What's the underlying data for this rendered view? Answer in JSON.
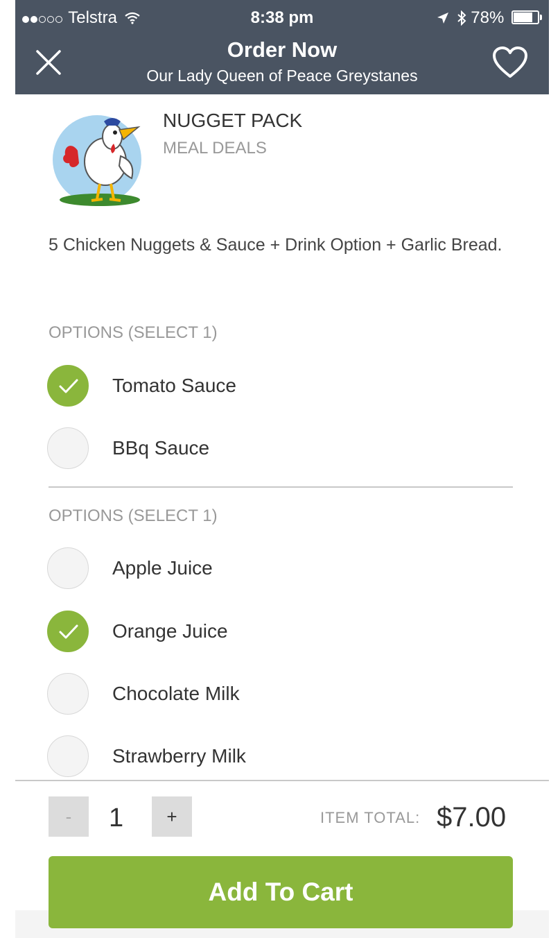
{
  "status_bar": {
    "carrier": "Telstra",
    "time": "8:38 pm",
    "battery": "78%",
    "battery_level": 0.78
  },
  "nav": {
    "title": "Order Now",
    "subtitle": "Our Lady Queen of Peace Greystanes"
  },
  "item": {
    "name": "NUGGET PACK",
    "category": "MEAL DEALS",
    "description": "5 Chicken Nuggets & Sauce + Drink Option + Garlic Bread."
  },
  "option_groups": [
    {
      "title": "OPTIONS (SELECT 1)",
      "options": [
        {
          "label": "Tomato Sauce",
          "selected": true
        },
        {
          "label": "BBq Sauce",
          "selected": false
        }
      ]
    },
    {
      "title": "OPTIONS (SELECT 1)",
      "options": [
        {
          "label": "Apple Juice",
          "selected": false
        },
        {
          "label": "Orange Juice",
          "selected": true
        },
        {
          "label": "Chocolate Milk",
          "selected": false
        },
        {
          "label": "Strawberry Milk",
          "selected": false
        }
      ]
    }
  ],
  "footer": {
    "minus": "-",
    "plus": "+",
    "quantity": "1",
    "total_label": "ITEM TOTAL:",
    "total": "$7.00",
    "add_to_cart": "Add To Cart"
  },
  "colors": {
    "header_bg": "#4a5462",
    "accent_green": "#8ab63c"
  }
}
